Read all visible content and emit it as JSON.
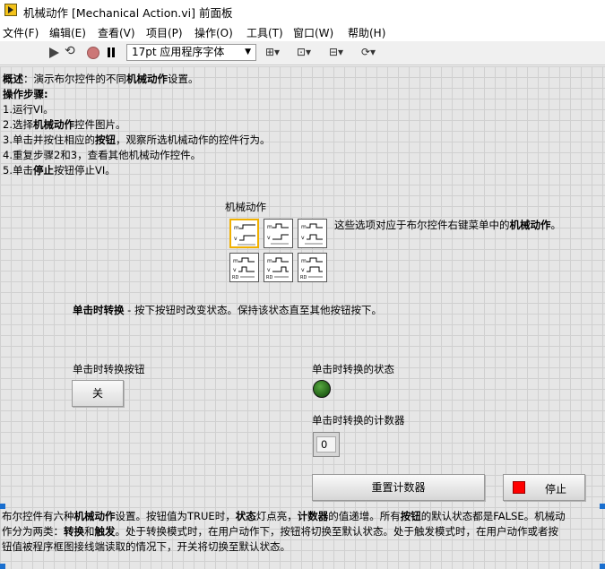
{
  "window": {
    "title": "机械动作 [Mechanical Action.vi] 前面板"
  },
  "menu": [
    "文件(F)",
    "编辑(E)",
    "查看(V)",
    "项目(P)",
    "操作(O)",
    "工具(T)",
    "窗口(W)",
    "帮助(H)"
  ],
  "toolbar": {
    "font": "17pt 应用程序字体"
  },
  "overview": {
    "label": "概述",
    "text_a": "：演示布尔控件的不同",
    "bold": "机械动作",
    "text_b": "设置。"
  },
  "steps": {
    "title": "操作步骤:",
    "s1": "1.运行VI。",
    "s2_a": "2.选择",
    "s2_b": "机械动作",
    "s2_c": "控件图片。",
    "s3_a": "3.单击并按住相应的",
    "s3_b": "按钮",
    "s3_c": "，观察所选机械动作的控件行为。",
    "s4": "4.重复步骤2和3，查看其他机械动作控件。",
    "s5_a": "5.单击",
    "s5_b": "停止",
    "s5_c": "按钮停止VI。"
  },
  "mechanical": {
    "title": "机械动作",
    "desc_a": "这些选项对应于布尔控件右键菜单中的",
    "desc_b": "机械动作",
    "desc_c": "。",
    "selected_index": 0
  },
  "action": {
    "name": "单击时转换",
    "text": " - 按下按钮时改变状态。保持该状态直至其他按钮按下。"
  },
  "controls": {
    "button_label": "单击时转换按钮",
    "button_text": "关",
    "state_label": "单击时转换的状态",
    "led_color": "#2a7a1e",
    "counter_label": "单击时转换的计数器",
    "counter_value": "0",
    "reset_label": "重置计数器",
    "stop_label": "停止"
  },
  "footer": {
    "l1_a": "布尔控件有六种",
    "l1_b": "机械动作",
    "l1_c": "设置。按钮值为TRUE时，",
    "l1_d": "状态",
    "l1_e": "灯点亮，",
    "l1_f": "计数器",
    "l1_g": "的值递增。所有",
    "l1_h": "按钮",
    "l1_i": "的默认状态都是FALSE。机械动",
    "l2_a": "作分为两类：",
    "l2_b": "转换",
    "l2_c": "和",
    "l2_d": "触发",
    "l2_e": "。处于转换模式时，在用户动作下，按钮将切换至默认状态。处于触发模式时，在用户动作或者按",
    "l3": "钮值被程序框图接线端读取的情况下，开关将切换至默认状态。"
  }
}
